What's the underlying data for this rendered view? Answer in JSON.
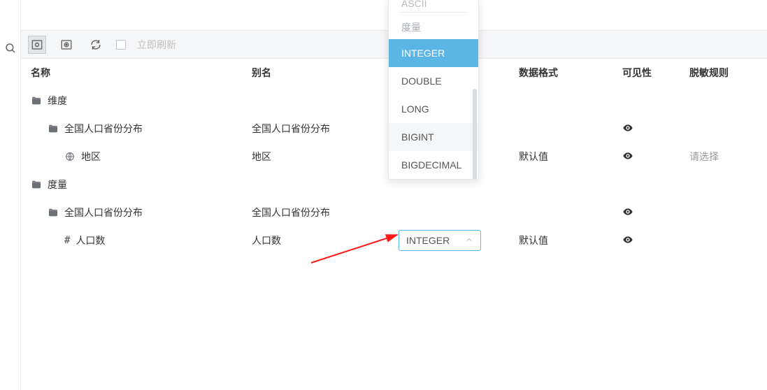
{
  "toolbar": {
    "refresh_label": "立即刷新"
  },
  "columns": {
    "name": "名称",
    "alias": "别名",
    "fmt": "数据格式",
    "vis": "可见性",
    "rule": "脱敏规则"
  },
  "sections": {
    "dimension": "维度",
    "measure": "度量"
  },
  "groups": {
    "provinceDist": "全国人口省份分布"
  },
  "rows": {
    "region": {
      "name": "地区",
      "alias": "地区",
      "fmt": "默认值",
      "rule": "请选择"
    },
    "pop": {
      "name": "人口数",
      "alias": "人口数",
      "fmt": "默认值"
    }
  },
  "select": {
    "current": "INTEGER"
  },
  "dropdown": {
    "clipped": "ASCII",
    "group": "度量",
    "items": [
      "INTEGER",
      "DOUBLE",
      "LONG",
      "BIGINT",
      "BIGDECIMAL"
    ],
    "selected": "INTEGER",
    "hover": "BIGINT"
  }
}
